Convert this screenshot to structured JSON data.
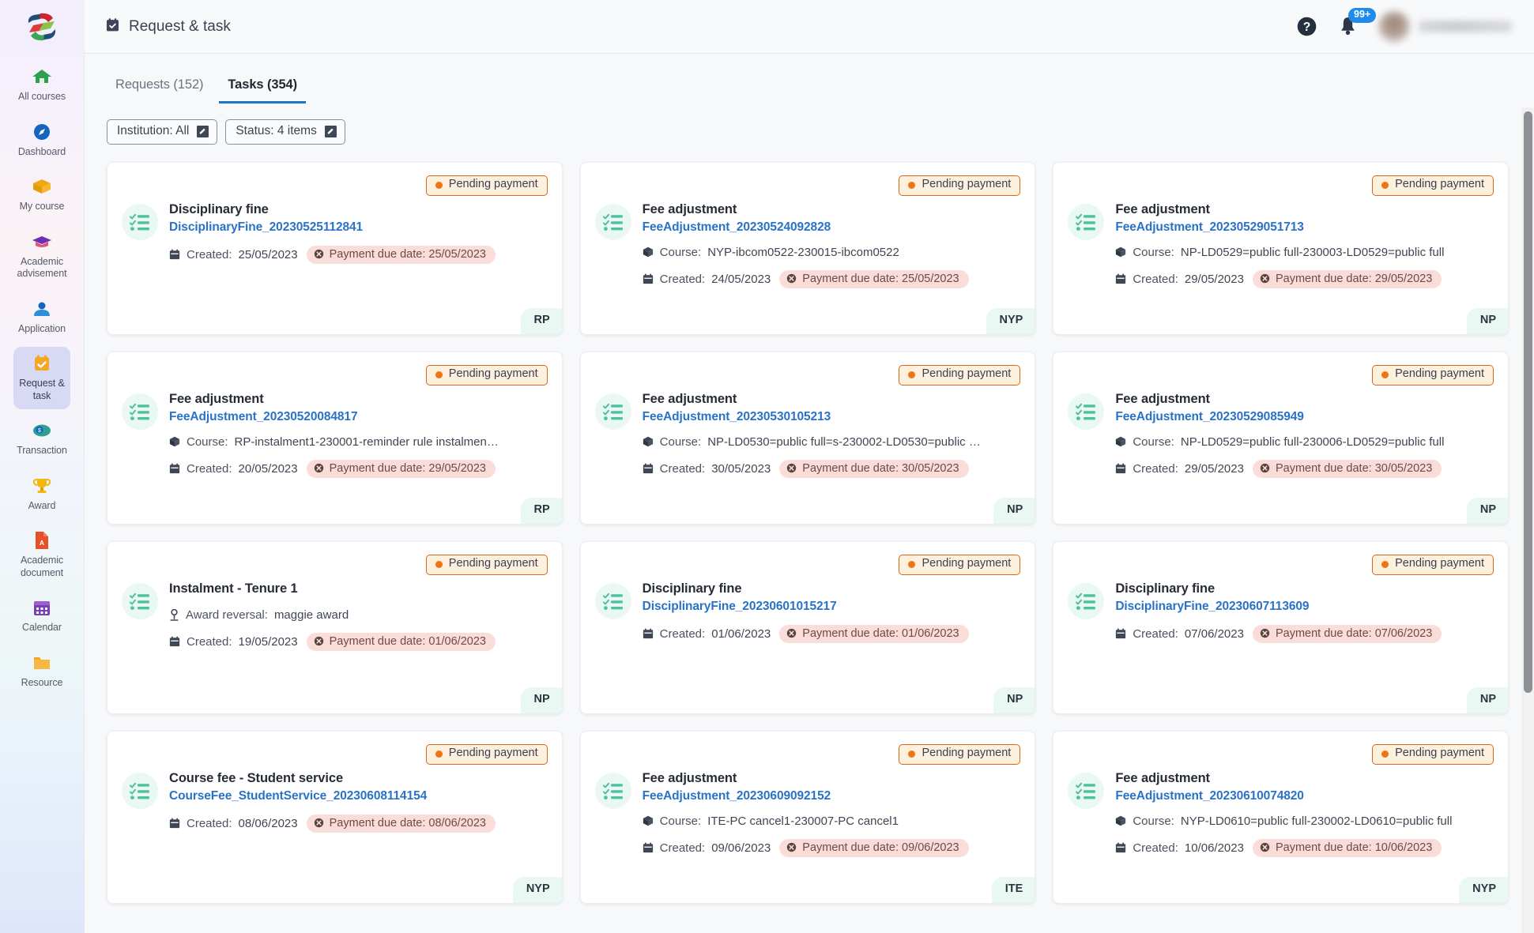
{
  "sidebar": {
    "logo": "logo-icon",
    "items": [
      {
        "label": "All courses",
        "icon": "home-icon",
        "active": false
      },
      {
        "label": "Dashboard",
        "icon": "compass-icon",
        "active": false
      },
      {
        "label": "My course",
        "icon": "box-icon",
        "active": false
      },
      {
        "label": "Academic advisement",
        "icon": "graduation-cap-icon",
        "active": false
      },
      {
        "label": "Application",
        "icon": "people-icon",
        "active": false
      },
      {
        "label": "Request & task",
        "icon": "calendar-check-icon",
        "active": true
      },
      {
        "label": "Transaction",
        "icon": "money-icon",
        "active": false
      },
      {
        "label": "Award",
        "icon": "trophy-icon",
        "active": false
      },
      {
        "label": "Academic document",
        "icon": "pdf-document-icon",
        "active": false
      },
      {
        "label": "Calendar",
        "icon": "calendar-icon",
        "active": false
      },
      {
        "label": "Resource",
        "icon": "folder-icon",
        "active": false
      }
    ]
  },
  "topbar": {
    "title": "Request & task",
    "title_icon": "calendar-check-icon",
    "help_icon": "help-circle-icon",
    "bell_icon": "bell-icon",
    "notification_count": "99+",
    "avatar": "user-avatar"
  },
  "tabs": [
    {
      "label": "Requests (152)",
      "active": false
    },
    {
      "label": "Tasks (354)",
      "active": true
    }
  ],
  "filters": [
    {
      "label": "Institution: All",
      "icon": "pencil-edit-icon"
    },
    {
      "label": "Status: 4 items",
      "icon": "pencil-edit-icon"
    }
  ],
  "labels": {
    "created": "Created:",
    "course": "Course:",
    "award_reversal": "Award reversal:",
    "card_icon": "checklist-icon",
    "status_icon": "status-dot-icon",
    "due_icon": "clock-alert-icon",
    "created_icon": "calendar-small-icon",
    "course_icon": "cube-icon",
    "award_icon": "award-person-icon"
  },
  "colors": {
    "accent": "#1976c4",
    "link": "#2a72c6",
    "status_border": "#d9661b",
    "status_bg": "#fdf0dd",
    "status_dot": "#ef7315",
    "due_bg": "#fadcd9",
    "institution_bg": "#e9f8f2",
    "sidebar_active_bg": "#d8d9f2"
  },
  "cards": [
    {
      "status": "Pending payment",
      "title": "Disciplinary fine",
      "ref": "DisciplinaryFine_20230525112841",
      "meta_type": "none",
      "meta_value": "",
      "created": "25/05/2023",
      "due": "Payment due date: 25/05/2023",
      "institution": "RP"
    },
    {
      "status": "Pending payment",
      "title": "Fee adjustment",
      "ref": "FeeAdjustment_20230524092828",
      "meta_type": "course",
      "meta_value": "NYP-ibcom0522-230015-ibcom0522",
      "created": "24/05/2023",
      "due": "Payment due date: 25/05/2023",
      "institution": "NYP"
    },
    {
      "status": "Pending payment",
      "title": "Fee adjustment",
      "ref": "FeeAdjustment_20230529051713",
      "meta_type": "course",
      "meta_value": "NP-LD0529=public full-230003-LD0529=public full",
      "created": "29/05/2023",
      "due": "Payment due date: 29/05/2023",
      "institution": "NP"
    },
    {
      "status": "Pending payment",
      "title": "Fee adjustment",
      "ref": "FeeAdjustment_20230520084817",
      "meta_type": "course",
      "meta_value": "RP-instalment1-230001-reminder rule instalmen…",
      "created": "20/05/2023",
      "due": "Payment due date: 29/05/2023",
      "institution": "RP"
    },
    {
      "status": "Pending payment",
      "title": "Fee adjustment",
      "ref": "FeeAdjustment_20230530105213",
      "meta_type": "course",
      "meta_value": "NP-LD0530=public full=s-230002-LD0530=public …",
      "created": "30/05/2023",
      "due": "Payment due date: 30/05/2023",
      "institution": "NP"
    },
    {
      "status": "Pending payment",
      "title": "Fee adjustment",
      "ref": "FeeAdjustment_20230529085949",
      "meta_type": "course",
      "meta_value": "NP-LD0529=public full-230006-LD0529=public full",
      "created": "29/05/2023",
      "due": "Payment due date: 30/05/2023",
      "institution": "NP"
    },
    {
      "status": "Pending payment",
      "title": "Instalment - Tenure 1",
      "ref": "",
      "meta_type": "award",
      "meta_value": "maggie award",
      "created": "19/05/2023",
      "due": "Payment due date: 01/06/2023",
      "institution": "NP"
    },
    {
      "status": "Pending payment",
      "title": "Disciplinary fine",
      "ref": "DisciplinaryFine_20230601015217",
      "meta_type": "none",
      "meta_value": "",
      "created": "01/06/2023",
      "due": "Payment due date: 01/06/2023",
      "institution": "NP"
    },
    {
      "status": "Pending payment",
      "title": "Disciplinary fine",
      "ref": "DisciplinaryFine_20230607113609",
      "meta_type": "none",
      "meta_value": "",
      "created": "07/06/2023",
      "due": "Payment due date: 07/06/2023",
      "institution": "NP"
    },
    {
      "status": "Pending payment",
      "title": "Course fee - Student service",
      "ref": "CourseFee_StudentService_20230608114154",
      "meta_type": "none",
      "meta_value": "",
      "created": "08/06/2023",
      "due": "Payment due date: 08/06/2023",
      "institution": "NYP"
    },
    {
      "status": "Pending payment",
      "title": "Fee adjustment",
      "ref": "FeeAdjustment_20230609092152",
      "meta_type": "course",
      "meta_value": "ITE-PC cancel1-230007-PC cancel1",
      "created": "09/06/2023",
      "due": "Payment due date: 09/06/2023",
      "institution": "ITE"
    },
    {
      "status": "Pending payment",
      "title": "Fee adjustment",
      "ref": "FeeAdjustment_20230610074820",
      "meta_type": "course",
      "meta_value": "NYP-LD0610=public full-230002-LD0610=public full",
      "created": "10/06/2023",
      "due": "Payment due date: 10/06/2023",
      "institution": "NYP"
    }
  ]
}
